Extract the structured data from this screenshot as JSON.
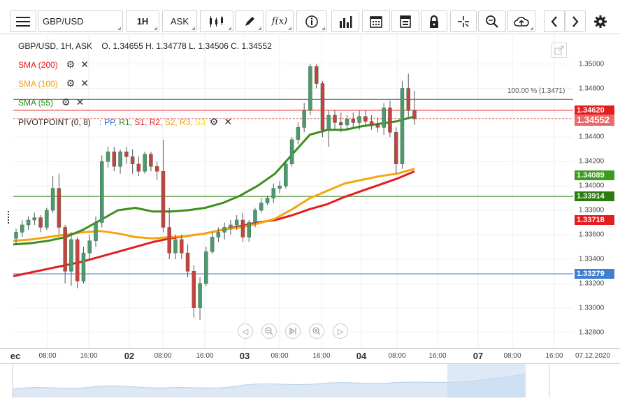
{
  "toolbar": {
    "symbol": "GBP/USD",
    "interval": "1H",
    "price_side": "ASK",
    "fx_label": "f(x)",
    "icons": [
      "menu-icon",
      "candles-icon",
      "pencil-icon",
      "fx-icon",
      "info-icon",
      "bars-icon",
      "calendar-icon",
      "report-icon",
      "lock-icon",
      "crosshair-icon",
      "zoom-search-icon",
      "upload-cloud-icon",
      "chevron-left-icon",
      "chevron-right-icon",
      "gear-icon"
    ]
  },
  "info_line": "GBP/USD, 1H, ASK    O. 1.34655 H. 1.34778 L. 1.34506 C. 1.34552",
  "legend": {
    "sma200": "SMA (200)",
    "sma100": "SMA (100)",
    "sma55": "SMA (55)",
    "pivot_name": "PIVOTPOINT (0, 8)",
    "pivot_colon": ":",
    "pivot_items": [
      {
        "label": "PP,",
        "color": "#1a6fd6"
      },
      {
        "label": "R1,",
        "color": "#2a8a1a"
      },
      {
        "label": "S1,",
        "color": "#e41e1e"
      },
      {
        "label": "R2,",
        "color": "#e41e1e"
      },
      {
        "label": "S2,",
        "color": "#f0a10a"
      },
      {
        "label": "R3,",
        "color": "#f0a10a"
      },
      {
        "label": "S3",
        "color": "#f5e000"
      }
    ]
  },
  "level_labels": {
    "hundred_pct": "100.00 % (1.3471)"
  },
  "price_badges": [
    {
      "value": "1.34620",
      "y": 1.3462,
      "color": "#e41e1e"
    },
    {
      "value": "1.34552",
      "y": 1.34552,
      "color": "#e86a6a"
    },
    {
      "value": "1.34089",
      "y": 1.34089,
      "color": "#3c9b1e"
    },
    {
      "value": "1.33914",
      "y": 1.33914,
      "color": "#2a7a10"
    },
    {
      "value": "1.33718",
      "y": 1.33718,
      "color": "#e41e1e"
    },
    {
      "value": "1.33279",
      "y": 1.33279,
      "color": "#3d7fd1"
    }
  ],
  "colors": {
    "sma200": "#e41e1e",
    "sma100": "#f5a60c",
    "sma55": "#3c8f1c",
    "candle": "#4e9a6d",
    "bear": "#c9403e",
    "pivot_pp": "#3d7fd1",
    "pivot_r1": "#2a7a10",
    "pivot_s1": "#e41e1e"
  },
  "chart_data": {
    "type": "line",
    "title": "GBP/USD, 1H, ASK",
    "ylim": [
      1.326,
      1.3525
    ],
    "y_ticks": [
      "1.35000",
      "1.34800",
      "1.34600",
      "1.34400",
      "1.34200",
      "1.34000",
      "1.33800",
      "1.33600",
      "1.33400",
      "1.33200",
      "1.33000",
      "1.32800"
    ],
    "y_tick_values": [
      1.35,
      1.348,
      1.346,
      1.344,
      1.342,
      1.34,
      1.338,
      1.336,
      1.334,
      1.332,
      1.33,
      1.328
    ],
    "x_ticks": [
      {
        "label": "ec",
        "bold": true
      },
      {
        "label": "08:00"
      },
      {
        "label": "16:00"
      },
      {
        "label": "02",
        "bold": true
      },
      {
        "label": "08:00"
      },
      {
        "label": "16:00"
      },
      {
        "label": "03",
        "bold": true
      },
      {
        "label": "08:00"
      },
      {
        "label": "16:00"
      },
      {
        "label": "04",
        "bold": true
      },
      {
        "label": "08:00"
      },
      {
        "label": "16:00"
      },
      {
        "label": "07",
        "bold": true
      },
      {
        "label": "08:00"
      },
      {
        "label": "16:00"
      },
      {
        "label": "07.12.2020"
      }
    ],
    "candles": [
      [
        1.3357,
        1.3365,
        1.3352,
        1.3362
      ],
      [
        1.3362,
        1.3372,
        1.3358,
        1.3368
      ],
      [
        1.3368,
        1.3375,
        1.3364,
        1.3372
      ],
      [
        1.3372,
        1.3378,
        1.3368,
        1.3374
      ],
      [
        1.3374,
        1.3376,
        1.3362,
        1.3366
      ],
      [
        1.3366,
        1.3382,
        1.3364,
        1.338
      ],
      [
        1.338,
        1.3408,
        1.3378,
        1.3398
      ],
      [
        1.3398,
        1.341,
        1.336,
        1.3366
      ],
      [
        1.3366,
        1.3368,
        1.332,
        1.333
      ],
      [
        1.333,
        1.3362,
        1.3318,
        1.3356
      ],
      [
        1.3356,
        1.3358,
        1.3316,
        1.3322
      ],
      [
        1.3322,
        1.335,
        1.332,
        1.3345
      ],
      [
        1.3345,
        1.336,
        1.334,
        1.3355
      ],
      [
        1.3355,
        1.3375,
        1.335,
        1.337
      ],
      [
        1.337,
        1.3425,
        1.3366,
        1.342
      ],
      [
        1.342,
        1.3432,
        1.3415,
        1.3428
      ],
      [
        1.3428,
        1.3432,
        1.3412,
        1.3416
      ],
      [
        1.3416,
        1.343,
        1.341,
        1.3428
      ],
      [
        1.3428,
        1.3432,
        1.3418,
        1.3424
      ],
      [
        1.3424,
        1.343,
        1.341,
        1.3418
      ],
      [
        1.3418,
        1.3424,
        1.3408,
        1.3412
      ],
      [
        1.3412,
        1.3428,
        1.341,
        1.3426
      ],
      [
        1.3426,
        1.3428,
        1.3412,
        1.3416
      ],
      [
        1.3416,
        1.342,
        1.3405,
        1.3412
      ],
      [
        1.3412,
        1.3438,
        1.3362,
        1.3366
      ],
      [
        1.3366,
        1.3382,
        1.334,
        1.3345
      ],
      [
        1.3345,
        1.336,
        1.334,
        1.3356
      ],
      [
        1.3356,
        1.336,
        1.334,
        1.3345
      ],
      [
        1.3345,
        1.3352,
        1.3325,
        1.333
      ],
      [
        1.333,
        1.3335,
        1.3292,
        1.33
      ],
      [
        1.33,
        1.3325,
        1.329,
        1.332
      ],
      [
        1.332,
        1.335,
        1.3318,
        1.3346
      ],
      [
        1.3346,
        1.3362,
        1.3344,
        1.3358
      ],
      [
        1.3358,
        1.3366,
        1.3354,
        1.3362
      ],
      [
        1.3362,
        1.337,
        1.3356,
        1.3366
      ],
      [
        1.3366,
        1.3372,
        1.336,
        1.3368
      ],
      [
        1.3368,
        1.3376,
        1.3364,
        1.3372
      ],
      [
        1.3372,
        1.3378,
        1.3354,
        1.3358
      ],
      [
        1.3358,
        1.3372,
        1.3354,
        1.337
      ],
      [
        1.337,
        1.3382,
        1.3366,
        1.338
      ],
      [
        1.338,
        1.339,
        1.3378,
        1.3386
      ],
      [
        1.3386,
        1.3392,
        1.3384,
        1.339
      ],
      [
        1.339,
        1.3402,
        1.3386,
        1.3398
      ],
      [
        1.3398,
        1.3404,
        1.3394,
        1.34
      ],
      [
        1.34,
        1.342,
        1.3398,
        1.3418
      ],
      [
        1.3418,
        1.344,
        1.3416,
        1.3438
      ],
      [
        1.3438,
        1.3452,
        1.3434,
        1.3448
      ],
      [
        1.3448,
        1.3468,
        1.3444,
        1.3462
      ],
      [
        1.3462,
        1.35,
        1.3458,
        1.3498
      ],
      [
        1.3498,
        1.35,
        1.348,
        1.3484
      ],
      [
        1.3484,
        1.3486,
        1.344,
        1.3446
      ],
      [
        1.3446,
        1.3462,
        1.3432,
        1.3458
      ],
      [
        1.3458,
        1.3462,
        1.3446,
        1.3452
      ],
      [
        1.3452,
        1.346,
        1.3444,
        1.345
      ],
      [
        1.345,
        1.3458,
        1.3446,
        1.3455
      ],
      [
        1.3455,
        1.346,
        1.3448,
        1.3452
      ],
      [
        1.3452,
        1.3462,
        1.3446,
        1.3457
      ],
      [
        1.3457,
        1.3462,
        1.345,
        1.3453
      ],
      [
        1.3453,
        1.3458,
        1.3446,
        1.345
      ],
      [
        1.345,
        1.3456,
        1.3444,
        1.3448
      ],
      [
        1.3448,
        1.3468,
        1.3442,
        1.3464
      ],
      [
        1.3464,
        1.347,
        1.344,
        1.3444
      ],
      [
        1.3444,
        1.3448,
        1.341,
        1.3418
      ],
      [
        1.3418,
        1.3486,
        1.3414,
        1.348
      ],
      [
        1.348,
        1.3492,
        1.3456,
        1.3462
      ],
      [
        1.3462,
        1.3478,
        1.345,
        1.3455
      ]
    ],
    "series": [
      {
        "name": "SMA (200)",
        "values": [
          1.3326,
          1.3329,
          1.3332,
          1.3335,
          1.3338,
          1.3342,
          1.3346,
          1.335,
          1.3354,
          1.3357,
          1.3359,
          1.3361,
          1.3364,
          1.3367,
          1.337,
          1.3372,
          1.3376,
          1.3381,
          1.3385,
          1.3391,
          1.3396,
          1.3401,
          1.3406,
          1.3412
        ]
      },
      {
        "name": "SMA (100)",
        "values": [
          1.3355,
          1.3356,
          1.3358,
          1.336,
          1.3362,
          1.3363,
          1.3361,
          1.3358,
          1.3357,
          1.3358,
          1.3359,
          1.3361,
          1.3364,
          1.3366,
          1.3369,
          1.3373,
          1.3381,
          1.339,
          1.3396,
          1.3402,
          1.3405,
          1.3408,
          1.341,
          1.3414
        ]
      },
      {
        "name": "SMA (55)",
        "values": [
          1.3352,
          1.3353,
          1.3355,
          1.3358,
          1.3364,
          1.3372,
          1.338,
          1.3382,
          1.3379,
          1.3379,
          1.338,
          1.3382,
          1.3386,
          1.3392,
          1.34,
          1.341,
          1.3426,
          1.3442,
          1.3446,
          1.3446,
          1.3449,
          1.3451,
          1.3453,
          1.3457
        ]
      }
    ]
  }
}
